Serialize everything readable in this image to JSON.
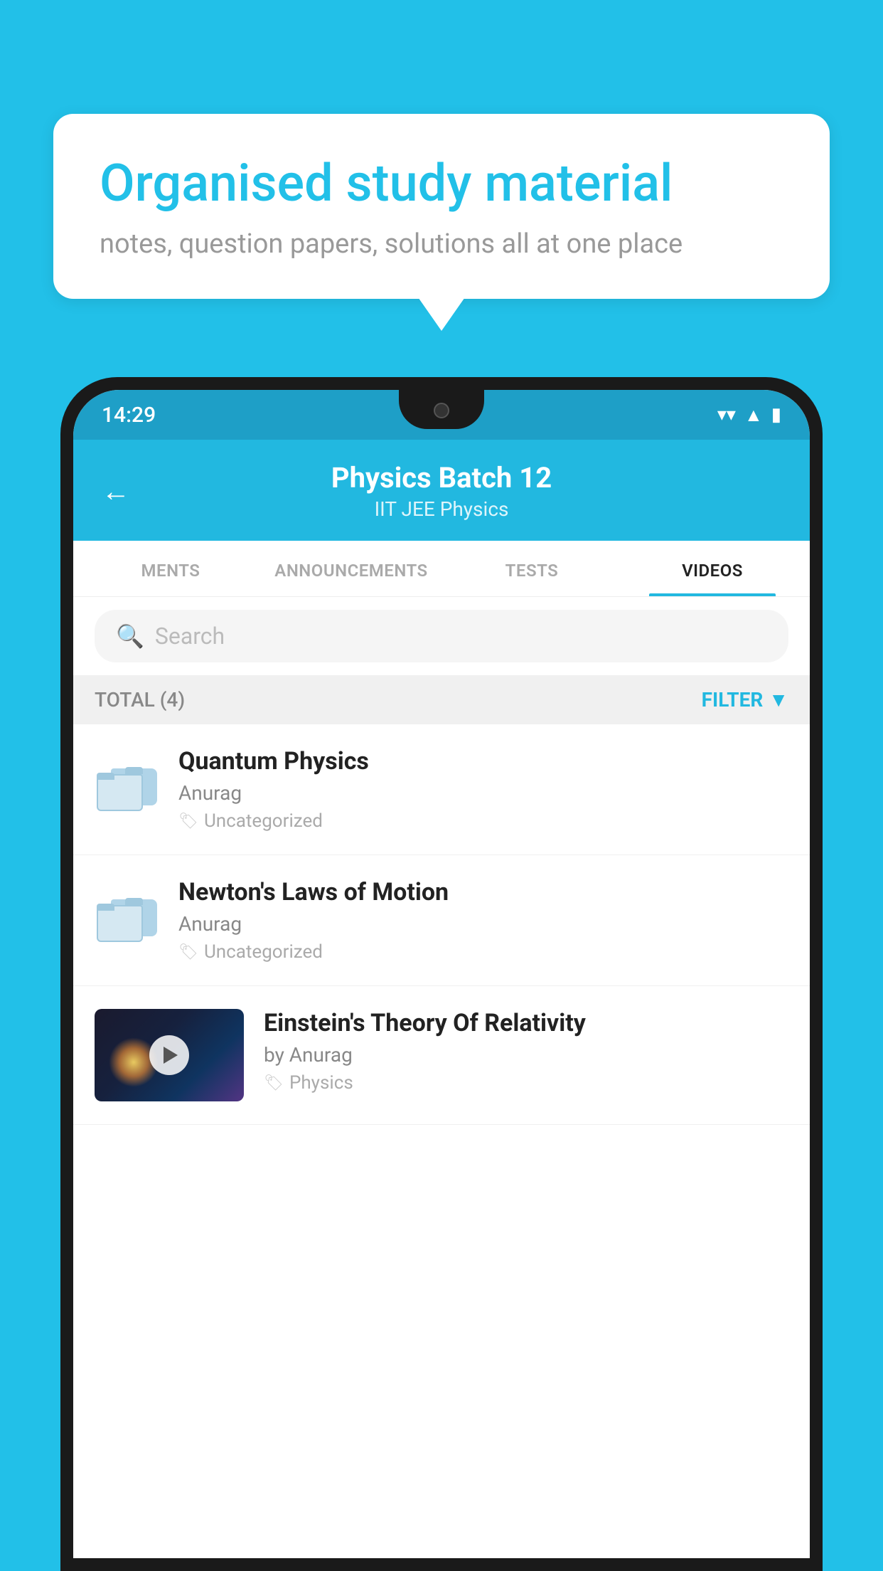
{
  "background_color": "#22c0e8",
  "speech_bubble": {
    "title": "Organised study material",
    "subtitle": "notes, question papers, solutions all at one place"
  },
  "phone": {
    "status_bar": {
      "time": "14:29",
      "icons": [
        "wifi",
        "signal",
        "battery"
      ]
    },
    "header": {
      "back_label": "←",
      "title": "Physics Batch 12",
      "subtitle": "IIT JEE   Physics"
    },
    "tabs": [
      {
        "label": "MENTS",
        "active": false
      },
      {
        "label": "ANNOUNCEMENTS",
        "active": false
      },
      {
        "label": "TESTS",
        "active": false
      },
      {
        "label": "VIDEOS",
        "active": true
      }
    ],
    "search": {
      "placeholder": "Search"
    },
    "filter_bar": {
      "total_label": "TOTAL (4)",
      "filter_label": "FILTER"
    },
    "videos": [
      {
        "id": "quantum",
        "title": "Quantum Physics",
        "author": "Anurag",
        "tag": "Uncategorized",
        "has_thumb": false
      },
      {
        "id": "newton",
        "title": "Newton's Laws of Motion",
        "author": "Anurag",
        "tag": "Uncategorized",
        "has_thumb": false
      },
      {
        "id": "einstein",
        "title": "Einstein's Theory Of Relativity",
        "author": "by Anurag",
        "tag": "Physics",
        "has_thumb": true
      }
    ]
  }
}
